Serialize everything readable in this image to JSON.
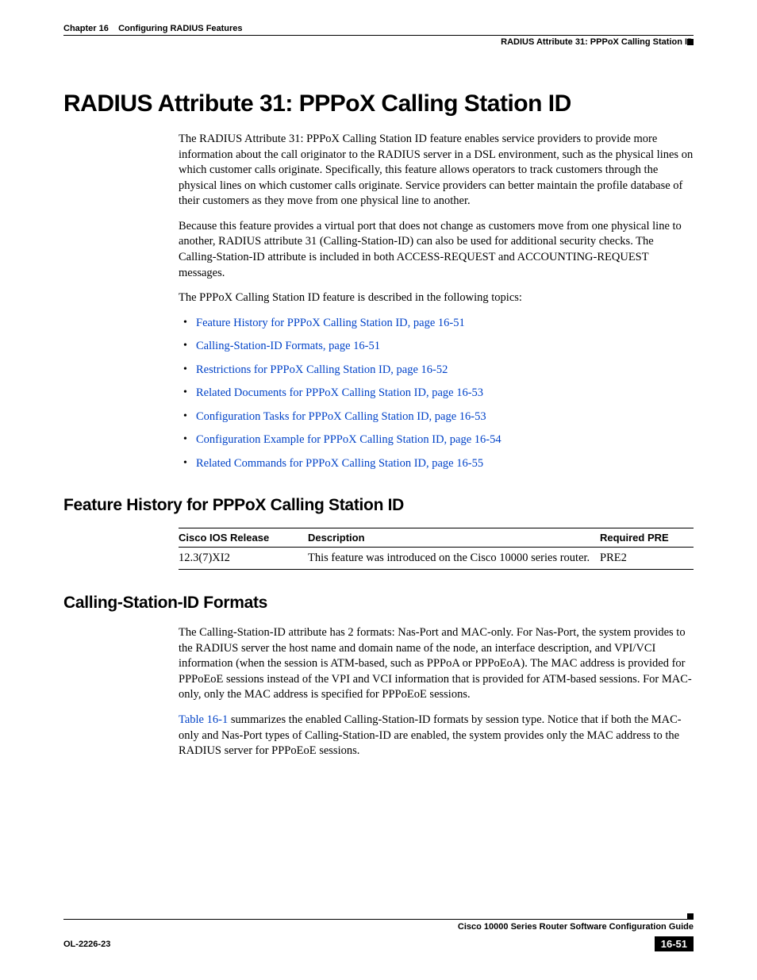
{
  "header": {
    "chapter_label": "Chapter 16",
    "chapter_title": "Configuring RADIUS Features",
    "section_title": "RADIUS Attribute 31: PPPoX Calling Station ID"
  },
  "h1": "RADIUS Attribute 31: PPPoX Calling Station ID",
  "intro_p1": "The RADIUS Attribute 31: PPPoX Calling Station ID feature enables service providers to provide more information about the call originator to the RADIUS server in a DSL environment, such as the physical lines on which customer calls originate. Specifically, this feature allows operators to track customers through the physical lines on which customer calls originate. Service providers can better maintain the profile database of their customers as they move from one physical line to another.",
  "intro_p2": "Because this feature provides a virtual port that does not change as customers move from one physical line to another, RADIUS attribute 31 (Calling-Station-ID) can also be used for additional security checks. The Calling-Station-ID attribute is included in both ACCESS-REQUEST and ACCOUNTING-REQUEST messages.",
  "intro_p3": "The PPPoX Calling Station ID feature is described in the following topics:",
  "topics": [
    "Feature History for PPPoX Calling Station ID, page 16-51",
    "Calling-Station-ID Formats, page 16-51",
    "Restrictions for PPPoX Calling Station ID, page 16-52",
    "Related Documents for PPPoX Calling Station ID, page 16-53",
    "Configuration Tasks for PPPoX Calling Station ID, page 16-53",
    "Configuration Example for PPPoX Calling Station ID, page 16-54",
    "Related Commands for PPPoX Calling Station ID, page 16-55"
  ],
  "h2_history": "Feature History for PPPoX Calling Station ID",
  "table": {
    "headers": {
      "release": "Cisco IOS Release",
      "description": "Description",
      "pre": "Required PRE"
    },
    "row": {
      "release": "12.3(7)XI2",
      "description": "This feature was introduced on the Cisco 10000 series router.",
      "pre": "PRE2"
    }
  },
  "h2_formats": "Calling-Station-ID Formats",
  "formats_p1": "The Calling-Station-ID attribute has 2 formats: Nas-Port and MAC-only. For Nas-Port, the system provides to the RADIUS server the host name and domain name of the node, an interface description, and VPI/VCI information (when the session is ATM-based, such as PPPoA or PPPoEoA). The MAC address is provided for PPPoEoE sessions instead of the VPI and VCI information that is provided for ATM-based sessions. For MAC-only, only the MAC address is specified for PPPoEoE sessions.",
  "formats_p2_link": "Table 16-1",
  "formats_p2_rest": " summarizes the enabled Calling-Station-ID formats by session type. Notice that if both the MAC-only and Nas-Port types of Calling-Station-ID are enabled, the system provides only the MAC address to the RADIUS server for PPPoEoE sessions.",
  "footer": {
    "guide": "Cisco 10000 Series Router Software Configuration Guide",
    "ol": "OL-2226-23",
    "pagenum": "16-51"
  }
}
